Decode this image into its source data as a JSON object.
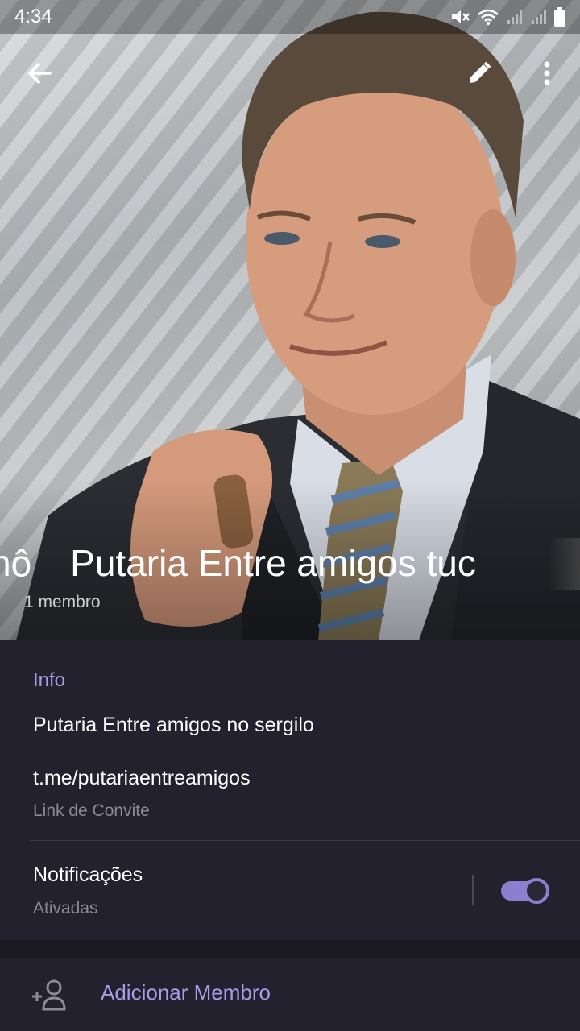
{
  "status_bar": {
    "time": "4:34"
  },
  "header": {
    "title_prefix": "nô",
    "title": "Putaria Entre amigos tuc",
    "member_count": "1 membro"
  },
  "info": {
    "section_header": "Info",
    "description": "Putaria Entre amigos no sergilo",
    "invite_link": "t.me/putariaentreamigos",
    "invite_link_label": "Link de Convite"
  },
  "notifications": {
    "title": "Notificações",
    "state": "Ativadas",
    "enabled": true
  },
  "actions": {
    "add_member_label": "Adicionar Membro"
  },
  "colors": {
    "accent": "#a99be6",
    "toggle": "#8c7fd0",
    "background": "#23212d",
    "secondary_text": "#8b8a95"
  },
  "icons": {
    "back": "arrow-left-icon",
    "edit": "pencil-icon",
    "more": "more-vert-icon",
    "add_member": "add-person-icon"
  }
}
